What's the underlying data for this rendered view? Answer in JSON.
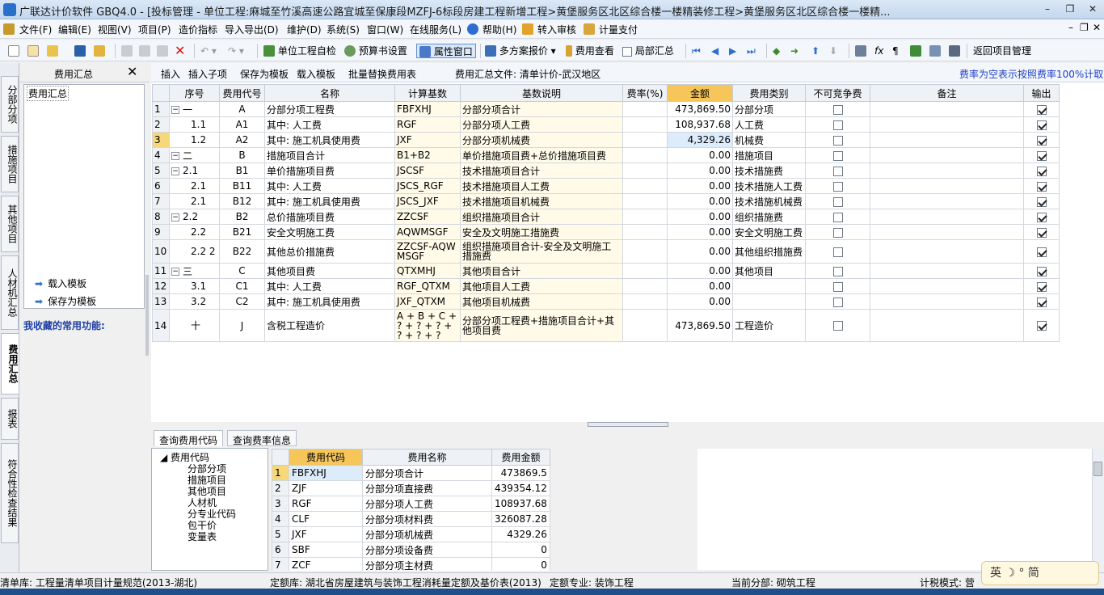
{
  "window": {
    "title": "广联达计价软件 GBQ4.0 - [投标管理 - 单位工程:麻城至竹溪高速公路宜城至保康段MZFJ-6标段房建工程新增工程>黄堡服务区北区综合楼一楼精装修工程>黄堡服务区北区综合楼一楼精...",
    "minimize": "–",
    "restore": "❐",
    "close": "✕"
  },
  "menu": [
    "文件(F)",
    "编辑(E)",
    "视图(V)",
    "项目(P)",
    "造价指标",
    "导入导出(D)",
    "维护(D)",
    "系统(S)",
    "窗口(W)",
    "在线服务(L)",
    "帮助(H)",
    "转入审核",
    "计量支付"
  ],
  "toolbar": {
    "unit_check": "单位工程自检",
    "budget_setting": "预算书设置",
    "property_window": "属性窗口",
    "multi_quote": "多方案报价",
    "fee_view": "费用查看",
    "partial_summary": "局部汇总",
    "return_project": "返回项目管理"
  },
  "vtabs": [
    "分部分项",
    "措施项目",
    "其他项目",
    "人材机汇总",
    "费用汇总",
    "报表",
    "符合性检查结果"
  ],
  "left_panel": {
    "header": "费用汇总",
    "tree_item": "费用汇总",
    "favorites_title": "我收藏的常用功能:",
    "links": [
      "载入模板",
      "保存为模板"
    ]
  },
  "subbar": {
    "insert": "插入",
    "insert_child": "插入子项",
    "save_template": "保存为模板",
    "load_template": "载入模板",
    "batch_replace": "批量替换费用表",
    "file_label": "费用汇总文件: 清单计价-武汉地区",
    "hint": "费率为空表示按照费率100%计取"
  },
  "grid": {
    "headers": [
      "",
      "序号",
      "费用代号",
      "名称",
      "计算基数",
      "基数说明",
      "费率(%)",
      "金额",
      "费用类别",
      "不可竞争费",
      "备注",
      "输出"
    ],
    "rows": [
      {
        "rn": "1",
        "exp": "−",
        "seq": "一",
        "code": "A",
        "name": "分部分项工程费",
        "base": "FBFXHJ",
        "desc": "分部分项合计",
        "rate": "",
        "amt": "473,869.50",
        "cat": "分部分项",
        "nc": false,
        "note": "",
        "out": true
      },
      {
        "rn": "2",
        "exp": "",
        "seq": "1.1",
        "code": "A1",
        "name": "其中: 人工费",
        "base": "RGF",
        "desc": "分部分项人工费",
        "rate": "",
        "amt": "108,937.68",
        "cat": "人工费",
        "nc": false,
        "note": "",
        "out": true
      },
      {
        "rn": "3",
        "exp": "",
        "seq": "1.2",
        "code": "A2",
        "name": "其中: 施工机具使用费",
        "base": "JXF",
        "desc": "分部分项机械费",
        "rate": "",
        "amt": "4,329.26",
        "cat": "机械费",
        "nc": false,
        "note": "",
        "out": true
      },
      {
        "rn": "4",
        "exp": "−",
        "seq": "二",
        "code": "B",
        "name": "措施项目合计",
        "base": "B1+B2",
        "desc": "单价措施项目费+总价措施项目费",
        "rate": "",
        "amt": "0.00",
        "cat": "措施项目",
        "nc": false,
        "note": "",
        "out": true
      },
      {
        "rn": "5",
        "exp": "−",
        "seq": "2.1",
        "code": "B1",
        "name": "单价措施项目费",
        "base": "JSCSF",
        "desc": "技术措施项目合计",
        "rate": "",
        "amt": "0.00",
        "cat": "技术措施费",
        "nc": false,
        "note": "",
        "out": true
      },
      {
        "rn": "6",
        "exp": "",
        "seq": "2.1",
        "code": "B11",
        "name": "其中: 人工费",
        "base": "JSCS_RGF",
        "desc": "技术措施项目人工费",
        "rate": "",
        "amt": "0.00",
        "cat": "技术措施人工费",
        "nc": false,
        "note": "",
        "out": true
      },
      {
        "rn": "7",
        "exp": "",
        "seq": "2.1",
        "code": "B12",
        "name": "其中: 施工机具使用费",
        "base": "JSCS_JXF",
        "desc": "技术措施项目机械费",
        "rate": "",
        "amt": "0.00",
        "cat": "技术措施机械费",
        "nc": false,
        "note": "",
        "out": true
      },
      {
        "rn": "8",
        "exp": "−",
        "seq": "2.2",
        "code": "B2",
        "name": "总价措施项目费",
        "base": "ZZCSF",
        "desc": "组织措施项目合计",
        "rate": "",
        "amt": "0.00",
        "cat": "组织措施费",
        "nc": false,
        "note": "",
        "out": true
      },
      {
        "rn": "9",
        "exp": "",
        "seq": "2.2",
        "code": "B21",
        "name": "安全文明施工费",
        "base": "AQWMSGF",
        "desc": "安全及文明施工措施费",
        "rate": "",
        "amt": "0.00",
        "cat": "安全文明施工费",
        "nc": false,
        "note": "",
        "out": true
      },
      {
        "rn": "10",
        "exp": "",
        "seq": "2.2 2",
        "code": "B22",
        "name": "其他总价措施费",
        "base": "ZZCSF-AQWMSGF",
        "desc": "组织措施项目合计-安全及文明施工措施费",
        "rate": "",
        "amt": "0.00",
        "cat": "其他组织措施费",
        "nc": false,
        "note": "",
        "out": true
      },
      {
        "rn": "11",
        "exp": "−",
        "seq": "三",
        "code": "C",
        "name": "其他项目费",
        "base": "QTXMHJ",
        "desc": "其他项目合计",
        "rate": "",
        "amt": "0.00",
        "cat": "其他项目",
        "nc": false,
        "note": "",
        "out": true
      },
      {
        "rn": "12",
        "exp": "",
        "seq": "3.1",
        "code": "C1",
        "name": "其中: 人工费",
        "base": "RGF_QTXM",
        "desc": "其他项目人工费",
        "rate": "",
        "amt": "0.00",
        "cat": "",
        "nc": false,
        "note": "",
        "out": true
      },
      {
        "rn": "13",
        "exp": "",
        "seq": "3.2",
        "code": "C2",
        "name": "其中: 施工机具使用费",
        "base": "JXF_QTXM",
        "desc": "其他项目机械费",
        "rate": "",
        "amt": "0.00",
        "cat": "",
        "nc": false,
        "note": "",
        "out": true
      },
      {
        "rn": "14",
        "exp": "",
        "seq": "十",
        "code": "J",
        "name": "含税工程造价",
        "base": "A + B + C + ? + ? + ? + ? + ? + ?",
        "desc": "分部分项工程费+措施项目合计+其他项目费",
        "rate": "",
        "amt": "473,869.50",
        "cat": "工程造价",
        "nc": false,
        "note": "",
        "out": true
      }
    ]
  },
  "bottom": {
    "tabs": [
      "查询费用代码",
      "查询费率信息"
    ],
    "tree": {
      "root": "费用代码",
      "children": [
        "分部分项",
        "措施项目",
        "其他项目",
        "人材机",
        "分专业代码",
        "包干价",
        "变量表"
      ]
    },
    "headers": [
      "",
      "费用代码",
      "费用名称",
      "费用金额"
    ],
    "rows": [
      {
        "rn": "1",
        "code": "FBFXHJ",
        "name": "分部分项合计",
        "amount": "473869.5"
      },
      {
        "rn": "2",
        "code": "ZJF",
        "name": "分部分项直接费",
        "amount": "439354.12"
      },
      {
        "rn": "3",
        "code": "RGF",
        "name": "分部分项人工费",
        "amount": "108937.68"
      },
      {
        "rn": "4",
        "code": "CLF",
        "name": "分部分项材料费",
        "amount": "326087.28"
      },
      {
        "rn": "5",
        "code": "JXF",
        "name": "分部分项机械费",
        "amount": "4329.26"
      },
      {
        "rn": "6",
        "code": "SBF",
        "name": "分部分项设备费",
        "amount": "0"
      },
      {
        "rn": "7",
        "code": "ZCF",
        "name": "分部分项主材费",
        "amount": "0"
      }
    ]
  },
  "status": {
    "list_lib": "清单库: 工程量清单项目计量规范(2013-湖北)",
    "quota_lib": "定额库: 湖北省房屋建筑与装饰工程消耗量定额及基价表(2013)",
    "quota_major": "定额专业: 装饰工程",
    "current_part": "当前分部: 砌筑工程",
    "tax_mode": "计税模式: 营"
  },
  "ime": "英 ☽ ° 简"
}
